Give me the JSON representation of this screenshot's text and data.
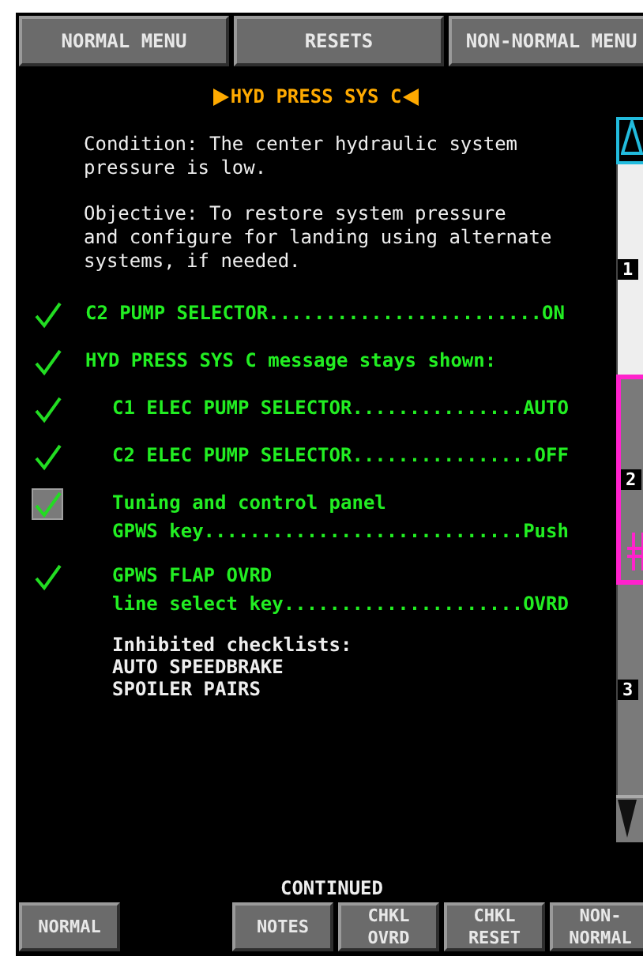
{
  "menu_buttons": [
    "NORMAL MENU",
    "RESETS",
    "NON-NORMAL MENU"
  ],
  "title": "HYD PRESS SYS C",
  "notes": [
    [
      "Condition: The center hydraulic system",
      "pressure is low."
    ],
    [
      "Objective: To restore system pressure",
      "and configure for landing using alternate",
      "systems, if needed."
    ]
  ],
  "steps": [
    {
      "kind": "closed_loop",
      "checked": true,
      "lines": [
        "C2 PUMP SELECTOR........................ON"
      ]
    },
    {
      "kind": "closed_loop",
      "checked": true,
      "lines": [
        "HYD PRESS SYS C message stays shown:"
      ],
      "children": [
        {
          "kind": "closed_loop",
          "checked": true,
          "lines": [
            "C1 ELEC PUMP SELECTOR...............AUTO"
          ]
        },
        {
          "kind": "closed_loop",
          "checked": true,
          "lines": [
            "C2 ELEC PUMP SELECTOR................OFF"
          ]
        },
        {
          "kind": "open_loop",
          "checked": true,
          "lines": [
            "Tuning and control panel",
            "GPWS key............................Push"
          ]
        },
        {
          "kind": "closed_loop",
          "checked": true,
          "lines": [
            "GPWS FLAP OVRD",
            "line select key.....................OVRD"
          ]
        },
        {
          "kind": "note",
          "lines": [
            "Inhibited checklists:",
            "AUTO SPEEDBRAKE",
            "SPOILER PAIRS"
          ]
        }
      ]
    }
  ],
  "scroll_pages": [
    {
      "label": "1",
      "in_view": true,
      "selected": false
    },
    {
      "label": "2",
      "in_view": false,
      "selected": true
    },
    {
      "label": "3",
      "in_view": false,
      "selected": false
    }
  ],
  "continued": "CONTINUED",
  "bottom_buttons": [
    {
      "lines": [
        "NORMAL"
      ]
    },
    {
      "lines": [
        "NOTES"
      ]
    },
    {
      "lines": [
        "CHKL",
        "OVRD"
      ]
    },
    {
      "lines": [
        "CHKL",
        "RESET"
      ]
    },
    {
      "lines": [
        "NON-",
        "NORMAL"
      ]
    }
  ]
}
